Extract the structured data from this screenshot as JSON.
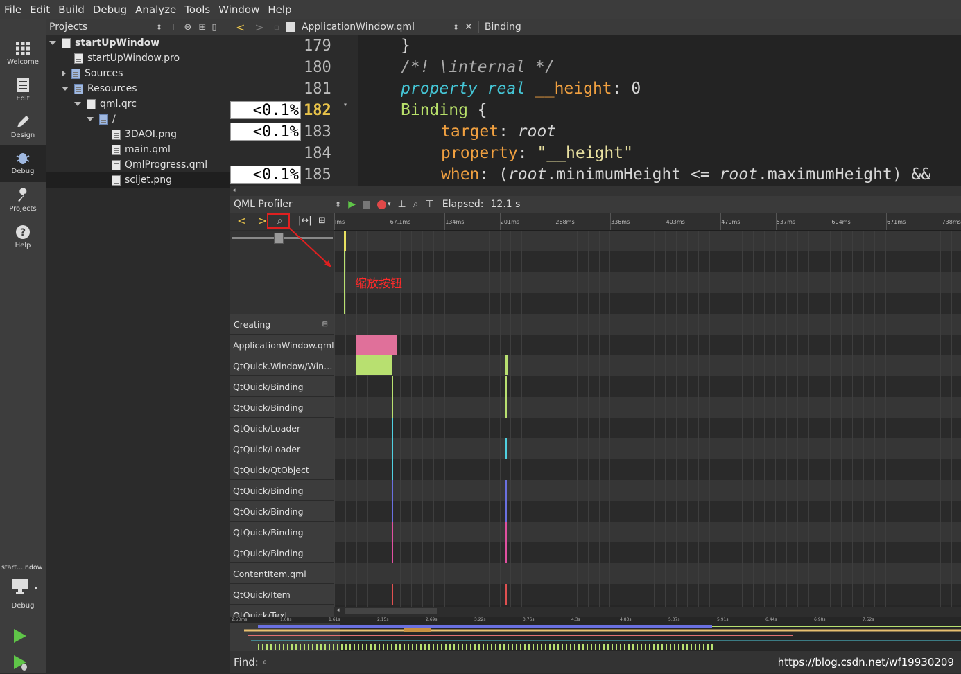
{
  "menu": [
    "File",
    "Edit",
    "Build",
    "Debug",
    "Analyze",
    "Tools",
    "Window",
    "Help"
  ],
  "modes": [
    {
      "label": "Welcome",
      "icon": "grid-icon"
    },
    {
      "label": "Edit",
      "icon": "document-icon"
    },
    {
      "label": "Design",
      "icon": "pencil-icon"
    },
    {
      "label": "Debug",
      "icon": "bug-icon"
    },
    {
      "label": "Projects",
      "icon": "wrench-icon"
    },
    {
      "label": "Help",
      "icon": "help-icon"
    }
  ],
  "kit": {
    "name": "start...indow",
    "mode": "Debug"
  },
  "projects": {
    "title": "Projects",
    "tree": [
      {
        "label": "startUpWindow",
        "depth": 0,
        "arrow": "down",
        "bold": true,
        "icon": "project-icon"
      },
      {
        "label": "startUpWindow.pro",
        "depth": 1,
        "arrow": "none",
        "icon": "pro-file-icon"
      },
      {
        "label": "Sources",
        "depth": 1,
        "arrow": "right",
        "icon": "folder-icon"
      },
      {
        "label": "Resources",
        "depth": 1,
        "arrow": "down",
        "icon": "folder-icon"
      },
      {
        "label": "qml.qrc",
        "depth": 2,
        "arrow": "down",
        "icon": "qrc-icon"
      },
      {
        "label": "/",
        "depth": 3,
        "arrow": "down",
        "icon": "folder-icon"
      },
      {
        "label": "3DAOI.png",
        "depth": 4,
        "arrow": "none",
        "icon": "file-icon"
      },
      {
        "label": "main.qml",
        "depth": 4,
        "arrow": "none",
        "icon": "qml-file-icon"
      },
      {
        "label": "QmlProgress.qml",
        "depth": 4,
        "arrow": "none",
        "icon": "qml-file-icon"
      },
      {
        "label": "scijet.png",
        "depth": 4,
        "arrow": "none",
        "icon": "file-icon",
        "selected": true
      }
    ]
  },
  "editor": {
    "file": "ApplicationWindow.qml",
    "symbol": "Binding",
    "lines": [
      {
        "no": "179",
        "pct": ""
      },
      {
        "no": "180",
        "pct": ""
      },
      {
        "no": "181",
        "pct": ""
      },
      {
        "no": "182",
        "pct": "<0.1%",
        "current": true
      },
      {
        "no": "183",
        "pct": "<0.1%"
      },
      {
        "no": "184",
        "pct": ""
      },
      {
        "no": "185",
        "pct": "<0.1%"
      }
    ]
  },
  "profiler": {
    "title": "QML Profiler",
    "elapsed_label": "Elapsed:",
    "elapsed_value": "12.1 s",
    "ticks": [
      "lms",
      "67.1ms",
      "134ms",
      "201ms",
      "268ms",
      "336ms",
      "403ms",
      "470ms",
      "537ms",
      "604ms",
      "671ms",
      "738ms"
    ],
    "category": "Creating",
    "rows": [
      "ApplicationWindow.qml",
      "QtQuick.Window/Wind…",
      "QtQuick/Binding",
      "QtQuick/Binding",
      "QtQuick/Loader",
      "QtQuick/Loader",
      "QtQuick/QtObject",
      "QtQuick/Binding",
      "QtQuick/Binding",
      "QtQuick/Binding",
      "QtQuick/Binding",
      "ContentItem.qml",
      "QtQuick/Item",
      "QtQuick/Text"
    ],
    "overview_ticks": [
      "2.53ms",
      "1.08s",
      "1.61s",
      "2.15s",
      "2.69s",
      "3.22s",
      "3.76s",
      "4.3s",
      "4.83s",
      "5.37s",
      "5.91s",
      "6.44s",
      "6.98s",
      "7.52s"
    ],
    "annotation": "缩放按钮",
    "colors": {
      "pink": "#e0709a",
      "green": "#b8e070",
      "yellow": "#e8e060",
      "cyan": "#50d0e0",
      "blue": "#6a70e0",
      "magenta": "#e050a0",
      "red": "#e05050"
    }
  },
  "find": {
    "label": "Find:"
  },
  "watermark": "https://blog.csdn.net/wf19930209"
}
